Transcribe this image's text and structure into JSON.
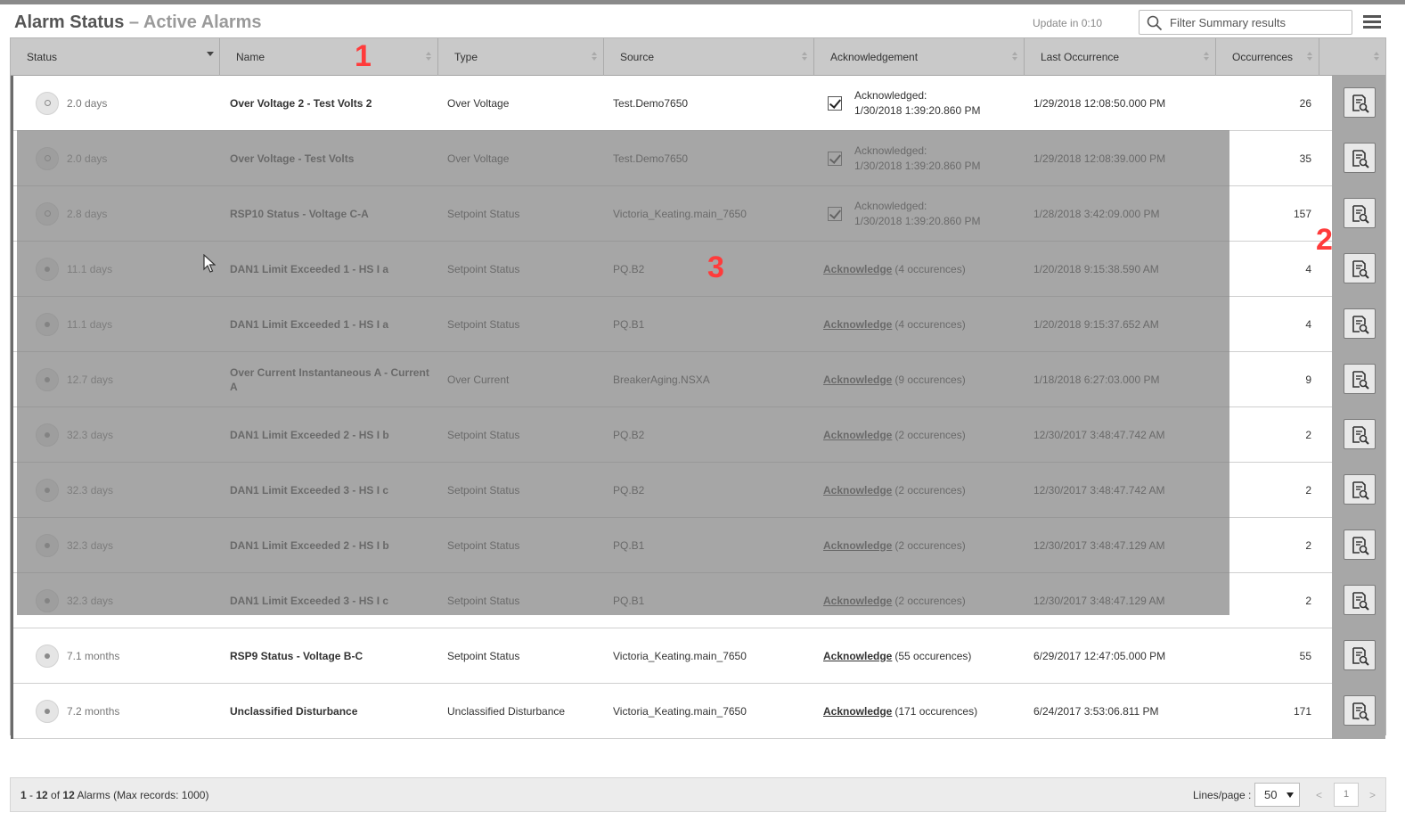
{
  "header": {
    "title": "Alarm Status",
    "separator": " – ",
    "subtitle": "Active Alarms",
    "update": "Update in 0:10",
    "filter_placeholder": "Filter Summary results"
  },
  "columns": [
    "Status",
    "Name",
    "Type",
    "Source",
    "Acknowledgement",
    "Last Occurrence",
    "Occurrences"
  ],
  "rows": [
    {
      "status": "2.0 days",
      "name": "Over Voltage 2 - Test Volts 2",
      "type": "Over Voltage",
      "source": "Test.Demo7650",
      "ack_done": true,
      "ack_line1": "Acknowledged:",
      "ack_line2": "1/30/2018 1:39:20.860 PM",
      "last": "1/29/2018 12:08:50.000 PM",
      "occ": "26"
    },
    {
      "status": "2.0 days",
      "name": "Over Voltage - Test Volts",
      "type": "Over Voltage",
      "source": "Test.Demo7650",
      "ack_done": true,
      "ack_line1": "Acknowledged:",
      "ack_line2": "1/30/2018 1:39:20.860 PM",
      "last": "1/29/2018 12:08:39.000 PM",
      "occ": "35"
    },
    {
      "status": "2.8 days",
      "name": "RSP10 Status - Voltage C-A",
      "type": "Setpoint Status",
      "source": "Victoria_Keating.main_7650",
      "ack_done": true,
      "ack_line1": "Acknowledged:",
      "ack_line2": "1/30/2018 1:39:20.860 PM",
      "last": "1/28/2018 3:42:09.000 PM",
      "occ": "157"
    },
    {
      "status": "11.1 days",
      "name": "DAN1 Limit Exceeded 1 - HS I a",
      "type": "Setpoint Status",
      "source": "PQ.B2",
      "ack_done": false,
      "ack_link": "Acknowledge",
      "ack_suffix": "(4 occurences)",
      "last": "1/20/2018 9:15:38.590 AM",
      "occ": "4"
    },
    {
      "status": "11.1 days",
      "name": "DAN1 Limit Exceeded 1 - HS I a",
      "type": "Setpoint Status",
      "source": "PQ.B1",
      "ack_done": false,
      "ack_link": "Acknowledge",
      "ack_suffix": "(4 occurences)",
      "last": "1/20/2018 9:15:37.652 AM",
      "occ": "4"
    },
    {
      "status": "12.7 days",
      "name": "Over Current Instantaneous A - Current A",
      "type": "Over Current",
      "source": "BreakerAging.NSXA",
      "ack_done": false,
      "ack_link": "Acknowledge",
      "ack_suffix": "(9 occurences)",
      "last": "1/18/2018 6:27:03.000 PM",
      "occ": "9"
    },
    {
      "status": "32.3 days",
      "name": "DAN1 Limit Exceeded 2 - HS I b",
      "type": "Setpoint Status",
      "source": "PQ.B2",
      "ack_done": false,
      "ack_link": "Acknowledge",
      "ack_suffix": "(2 occurences)",
      "last": "12/30/2017 3:48:47.742 AM",
      "occ": "2"
    },
    {
      "status": "32.3 days",
      "name": "DAN1 Limit Exceeded 3 - HS I c",
      "type": "Setpoint Status",
      "source": "PQ.B2",
      "ack_done": false,
      "ack_link": "Acknowledge",
      "ack_suffix": "(2 occurences)",
      "last": "12/30/2017 3:48:47.742 AM",
      "occ": "2"
    },
    {
      "status": "32.3 days",
      "name": "DAN1 Limit Exceeded 2 - HS I b",
      "type": "Setpoint Status",
      "source": "PQ.B1",
      "ack_done": false,
      "ack_link": "Acknowledge",
      "ack_suffix": "(2 occurences)",
      "last": "12/30/2017 3:48:47.129 AM",
      "occ": "2"
    },
    {
      "status": "32.3 days",
      "name": "DAN1 Limit Exceeded 3 - HS I c",
      "type": "Setpoint Status",
      "source": "PQ.B1",
      "ack_done": false,
      "ack_link": "Acknowledge",
      "ack_suffix": "(2 occurences)",
      "last": "12/30/2017 3:48:47.129 AM",
      "occ": "2"
    },
    {
      "status": "7.1 months",
      "name": "RSP9 Status - Voltage B-C",
      "type": "Setpoint Status",
      "source": "Victoria_Keating.main_7650",
      "ack_done": false,
      "ack_link": "Acknowledge",
      "ack_suffix": "(55 occurences)",
      "last": "6/29/2017 12:47:05.000 PM",
      "occ": "55"
    },
    {
      "status": "7.2 months",
      "name": "Unclassified Disturbance",
      "type": "Unclassified Disturbance",
      "source": "Victoria_Keating.main_7650",
      "ack_done": false,
      "ack_link": "Acknowledge",
      "ack_suffix": "(171 occurences)",
      "last": "6/24/2017 3:53:06.811 PM",
      "occ": "171"
    }
  ],
  "markers": [
    "1",
    "2",
    "3"
  ],
  "footer": {
    "range_start": "1",
    "range_sep": " - ",
    "range_end": "12",
    "of_word": " of ",
    "total": "12",
    "suffix": " Alarms (Max records: 1000)",
    "lines_label": "Lines/page :",
    "lines_value": "50",
    "prev": "<",
    "page": "1",
    "next": ">"
  },
  "colors": {
    "header_bg": "#c9c9c9",
    "overlay": "#808080",
    "marker": "#ff3b3b",
    "action_col": "#a7a7a7"
  }
}
